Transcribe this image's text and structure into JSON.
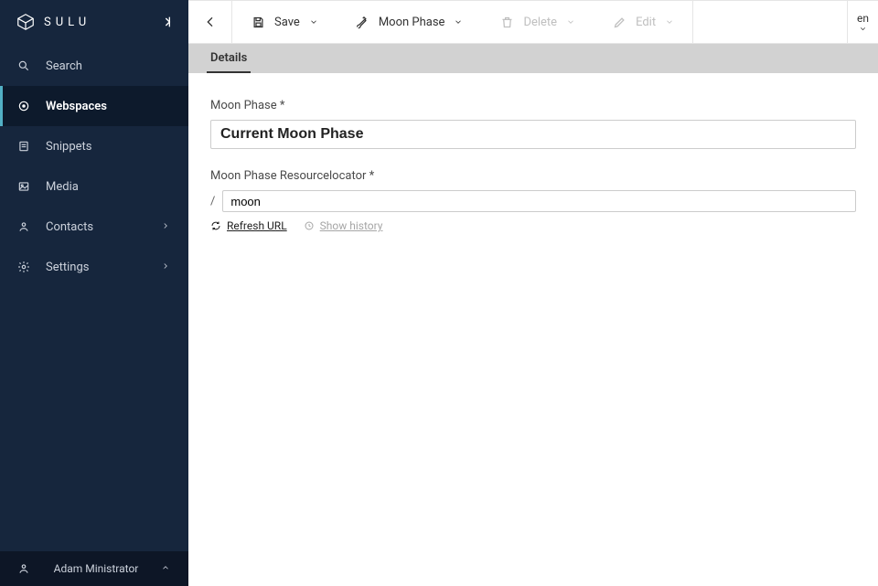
{
  "brand": {
    "name": "SULU"
  },
  "sidebar": {
    "items": [
      {
        "label": "Search"
      },
      {
        "label": "Webspaces"
      },
      {
        "label": "Snippets"
      },
      {
        "label": "Media"
      },
      {
        "label": "Contacts"
      },
      {
        "label": "Settings"
      }
    ],
    "user": {
      "name": "Adam Ministrator"
    }
  },
  "toolbar": {
    "save_label": "Save",
    "template_label": "Moon Phase",
    "delete_label": "Delete",
    "edit_label": "Edit",
    "language": "en"
  },
  "tabs": [
    {
      "label": "Details"
    }
  ],
  "form": {
    "moon_phase": {
      "label": "Moon Phase *",
      "value": "Current Moon Phase"
    },
    "resource_locator": {
      "label": "Moon Phase Resourcelocator *",
      "prefix": "/",
      "value": "moon",
      "refresh_label": "Refresh URL",
      "history_label": "Show history"
    }
  }
}
